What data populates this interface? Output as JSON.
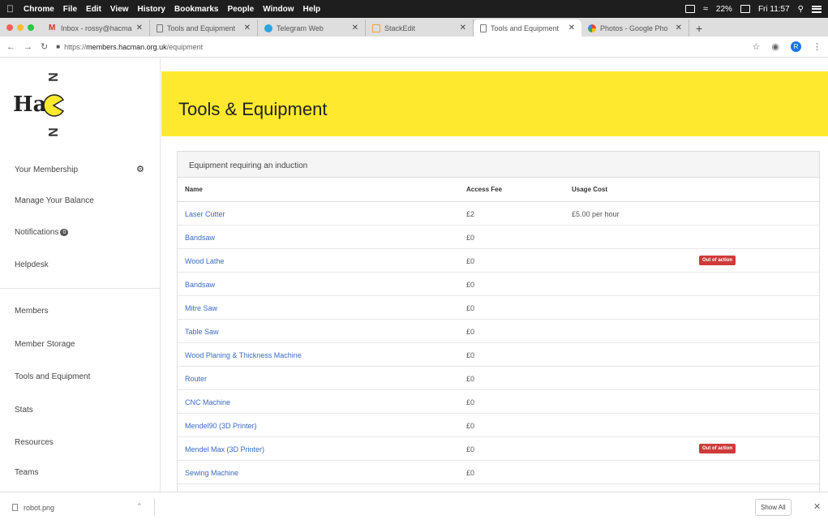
{
  "menubar": {
    "app": "Chrome",
    "menus": [
      "File",
      "Edit",
      "View",
      "History",
      "Bookmarks",
      "People",
      "Window",
      "Help"
    ],
    "battery": "22%",
    "clock": "Fri 11:57"
  },
  "tabs": [
    {
      "label": "Inbox - rossy@hacma",
      "icon": "gmail-icon",
      "color": "#d93025"
    },
    {
      "label": "Tools and Equipment",
      "icon": "page-icon",
      "color": "#777777"
    },
    {
      "label": "Telegram Web",
      "icon": "telegram-icon",
      "color": "#2ca5e0"
    },
    {
      "label": "StackEdit",
      "icon": "stackedit-icon",
      "color": "#f2a23c"
    },
    {
      "label": "Tools and Equipment",
      "icon": "page-icon",
      "color": "#777777",
      "active": true
    },
    {
      "label": "Photos - Google Pho",
      "icon": "photos-icon",
      "color": "#fbbc05"
    }
  ],
  "address": {
    "prefix": "https://",
    "host": "members.hacman.org.uk",
    "path": "/equipment",
    "profile_initial": "R"
  },
  "logo": {
    "text": "Ha",
    "letter": "N"
  },
  "sidebar": {
    "items": [
      {
        "label": "Your Membership"
      },
      {
        "label": "Manage Your Balance"
      },
      {
        "label": "Notifications",
        "badge": "0"
      },
      {
        "label": "Helpdesk"
      },
      {
        "label": "Members"
      },
      {
        "label": "Member Storage"
      },
      {
        "label": "Tools and Equipment"
      },
      {
        "label": "Stats"
      },
      {
        "label": "Resources"
      },
      {
        "label": "Teams"
      }
    ]
  },
  "header": {
    "title": "Tools & Equipment"
  },
  "panel": {
    "title": "Equipment requiring an induction",
    "columns": [
      "Name",
      "Access Fee",
      "Usage Cost"
    ],
    "rows": [
      {
        "name": "Laser Cutter",
        "fee": "£2",
        "cost": "£5.00 per hour",
        "status": ""
      },
      {
        "name": "Bandsaw",
        "fee": "£0",
        "cost": "",
        "status": ""
      },
      {
        "name": "Wood Lathe",
        "fee": "£0",
        "cost": "",
        "status": "Out of action"
      },
      {
        "name": "Bandsaw",
        "fee": "£0",
        "cost": "",
        "status": ""
      },
      {
        "name": "Mitre Saw",
        "fee": "£0",
        "cost": "",
        "status": ""
      },
      {
        "name": "Table Saw",
        "fee": "£0",
        "cost": "",
        "status": ""
      },
      {
        "name": "Wood Planing & Thickness Machine",
        "fee": "£0",
        "cost": "",
        "status": ""
      },
      {
        "name": "Router",
        "fee": "£0",
        "cost": "",
        "status": ""
      },
      {
        "name": "CNC Machine",
        "fee": "£0",
        "cost": "",
        "status": ""
      },
      {
        "name": "Mendel90 (3D Printer)",
        "fee": "£0",
        "cost": "",
        "status": ""
      },
      {
        "name": "Mendel Max (3D Printer)",
        "fee": "£0",
        "cost": "",
        "status": "Out of action"
      },
      {
        "name": "Sewing Machine",
        "fee": "£0",
        "cost": "",
        "status": ""
      }
    ]
  },
  "downloads": {
    "file": "robot.png",
    "show_all": "Show All"
  }
}
